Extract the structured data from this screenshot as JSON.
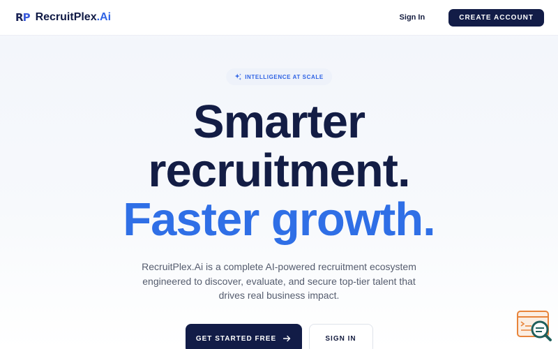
{
  "navbar": {
    "logo_mark": {
      "r": "R",
      "p": "P"
    },
    "brand": {
      "name": "RecruitPlex",
      "suffix": ".Ai"
    },
    "sign_in_label": "Sign In",
    "create_account_label": "CREATE ACCOUNT"
  },
  "hero": {
    "badge": {
      "icon": "sparkle-icon",
      "label": "INTELLIGENCE AT SCALE"
    },
    "headline": {
      "line1": "Smarter",
      "line2": "recruitment.",
      "line3": "Faster growth."
    },
    "subtext": "RecruitPlex.Ai is a complete AI-powered recruitment ecosystem engineered to discover, evaluate, and secure top-tier talent that drives real business impact.",
    "primary_cta": {
      "label": "GET STARTED FREE",
      "icon": "arrow-right-icon"
    },
    "secondary_cta": {
      "label": "SIGN IN"
    }
  },
  "chat_widget": {
    "icon": "chat-search-icon"
  },
  "colors": {
    "navy": "#121c47",
    "accent_blue": "#2f6fe6",
    "badge_bg": "#eef2fa",
    "widget_orange": "#e8843a",
    "widget_teal": "#1f5f5b"
  }
}
